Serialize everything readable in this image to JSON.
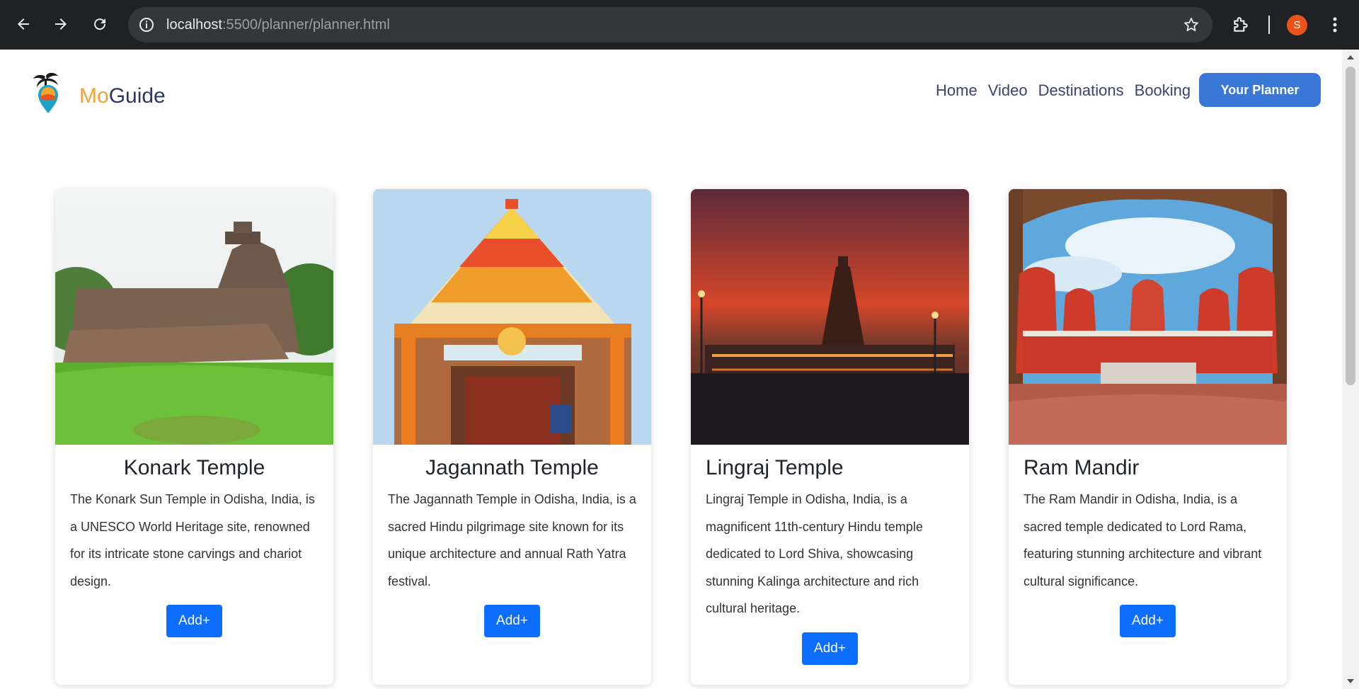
{
  "browser": {
    "url_host": "localhost",
    "url_path": ":5500/planner/planner.html",
    "profile_initial": "S"
  },
  "site": {
    "brand_mo": "Mo",
    "brand_guide": "Guide",
    "nav": [
      "Home",
      "Video",
      "Destinations",
      "Booking"
    ],
    "planner_button": "Your Planner"
  },
  "cards": [
    {
      "title": "Konark Temple",
      "description": "The Konark Sun Temple in Odisha, India, is a UNESCO World Heritage site, renowned for its intricate stone carvings and chariot design.",
      "button": "Add+"
    },
    {
      "title": "Jagannath Temple",
      "description": "The Jagannath Temple in Odisha, India, is a sacred Hindu pilgrimage site known for its unique architecture and annual Rath Yatra festival.",
      "button": "Add+"
    },
    {
      "title": "Lingraj Temple",
      "description": "Lingraj Temple in Odisha, India, is a magnificent 11th-century Hindu temple dedicated to Lord Shiva, showcasing stunning Kalinga architecture and rich cultural heritage.",
      "button": "Add+"
    },
    {
      "title": "Ram Mandir",
      "description": "The Ram Mandir in Odisha, India, is a sacred temple dedicated to Lord Rama, featuring stunning architecture and vibrant cultural significance.",
      "button": "Add+"
    }
  ],
  "colors": {
    "brand_orange": "#f0a23a",
    "brand_navy": "#2d3561",
    "planner_blue": "#3a78d8",
    "add_blue": "#0d6efd"
  }
}
